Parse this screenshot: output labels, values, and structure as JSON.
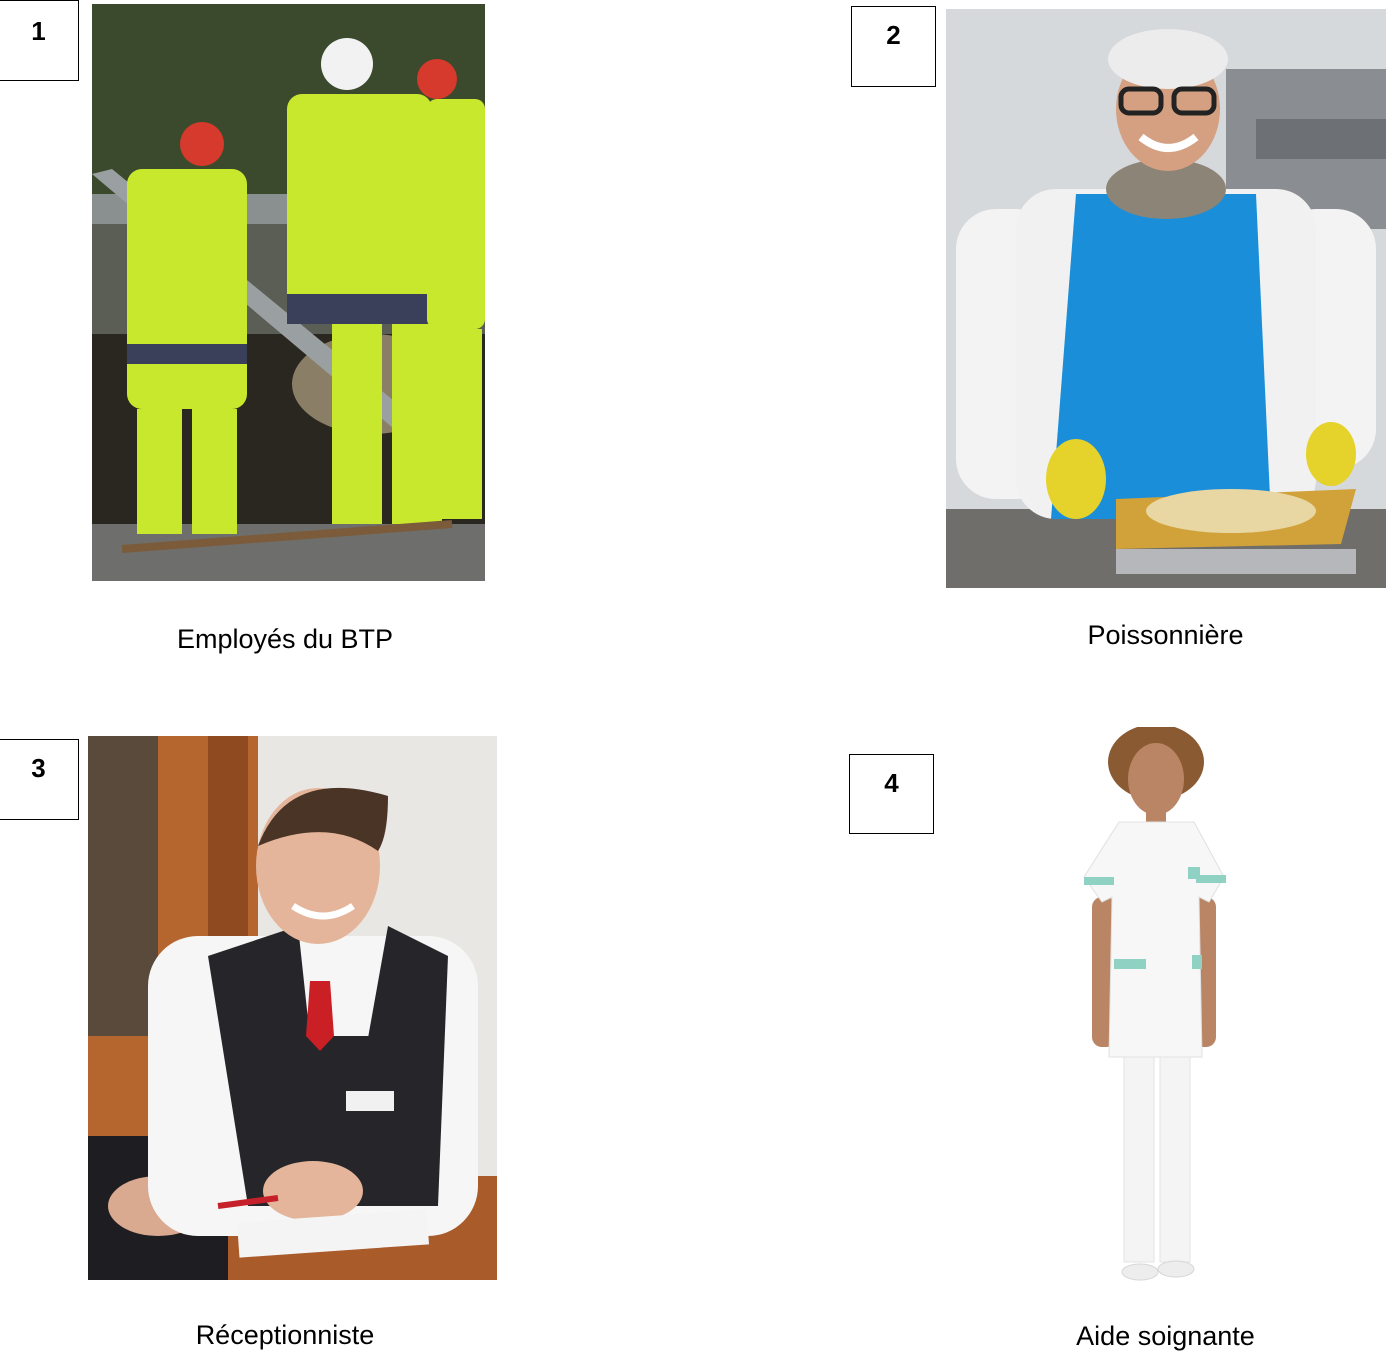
{
  "cards": [
    {
      "number": "1",
      "caption": "Employés du BTP"
    },
    {
      "number": "2",
      "caption": "Poissonnière"
    },
    {
      "number": "3",
      "caption": "Réceptionniste"
    },
    {
      "number": "4",
      "caption": "Aide soignante"
    }
  ]
}
